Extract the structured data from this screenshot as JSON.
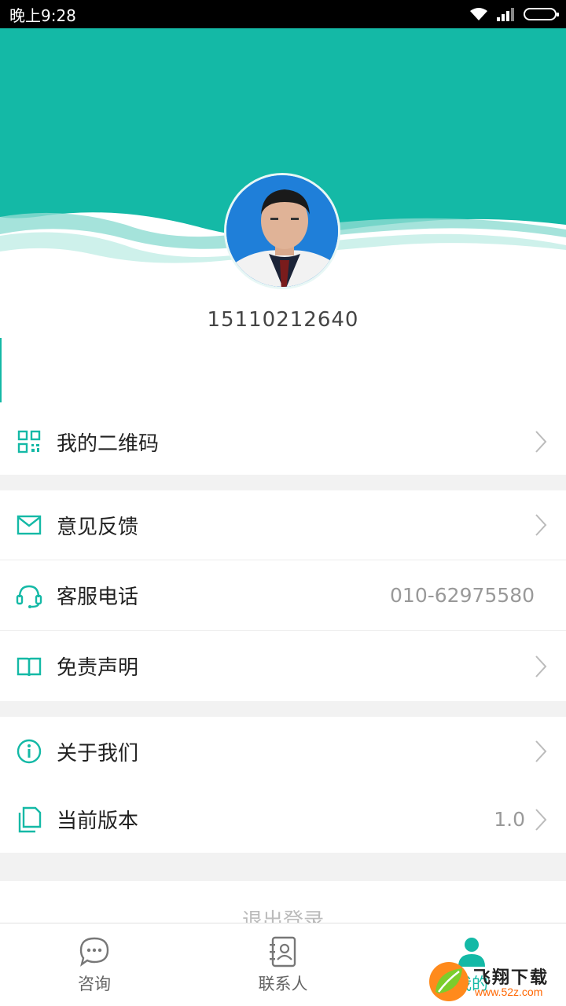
{
  "status_bar": {
    "time": "晚上9:28",
    "icons": [
      "wifi-icon",
      "signal-icon",
      "battery-icon"
    ]
  },
  "colors": {
    "accent": "#14b9a6",
    "header": "#14b9a6",
    "background": "#f2f2f2"
  },
  "profile": {
    "phone": "15110212640",
    "avatar": "doctor-avatar"
  },
  "menu": {
    "qrcode": {
      "label": "我的二维码",
      "icon": "qrcode-icon"
    },
    "feedback": {
      "label": "意见反馈",
      "icon": "mail-icon"
    },
    "service": {
      "label": "客服电话",
      "value": "010-62975580",
      "icon": "headset-icon"
    },
    "disclaimer": {
      "label": "免责声明",
      "icon": "book-icon"
    },
    "about": {
      "label": "关于我们",
      "icon": "info-icon"
    },
    "version": {
      "label": "当前版本",
      "value": "1.0",
      "icon": "document-icon"
    }
  },
  "logout_label": "退出登录",
  "tabs": [
    {
      "label": "咨询",
      "icon": "chat-bubble-icon",
      "active": false
    },
    {
      "label": "联系人",
      "icon": "contacts-icon",
      "active": false
    },
    {
      "label": "我的",
      "icon": "person-icon",
      "active": true
    }
  ],
  "watermark": {
    "title": "飞翔下载",
    "url": "www.52z.com"
  }
}
